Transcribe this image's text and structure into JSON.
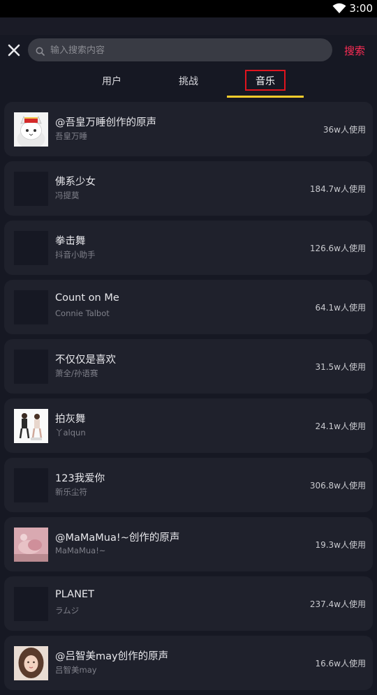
{
  "status_bar": {
    "time": "3:00",
    "wifi_icon": "wifi-icon"
  },
  "search": {
    "placeholder": "输入搜索内容",
    "value": "",
    "submit_label": "搜索"
  },
  "tabs": [
    {
      "label": "用户",
      "selected": false
    },
    {
      "label": "挑战",
      "selected": false
    },
    {
      "label": "音乐",
      "selected": true
    }
  ],
  "colors": {
    "accent": "#fe2c55",
    "tab_indicator": "#facd2c",
    "highlight_box": "#e0141e",
    "background": "#161823",
    "card": "#1f212c"
  },
  "music_list": [
    {
      "title": "@吾皇万睡创作的原声",
      "author": "吾皇万睡",
      "uses": "36w人使用",
      "cover": "cat-king-avatar"
    },
    {
      "title": "佛系少女",
      "author": "冯提莫",
      "uses": "184.7w人使用",
      "cover": "blank"
    },
    {
      "title": "拳击舞",
      "author": "抖音小助手",
      "uses": "126.6w人使用",
      "cover": "blank"
    },
    {
      "title": "Count on Me",
      "author": "Connie Talbot",
      "uses": "64.1w人使用",
      "cover": "blank"
    },
    {
      "title": "不仅仅是喜欢",
      "author": "萧全/孙语赛",
      "uses": "31.5w人使用",
      "cover": "blank"
    },
    {
      "title": "拍灰舞",
      "author": "丫alqun",
      "uses": "24.1w人使用",
      "cover": "dancers-photo"
    },
    {
      "title": "123我爱你",
      "author": "新乐尘符",
      "uses": "306.8w人使用",
      "cover": "blank"
    },
    {
      "title": "@MaMaMua!~创作的原声",
      "author": "MaMaMua!~",
      "uses": "19.3w人使用",
      "cover": "pink-photo"
    },
    {
      "title": "PLANET",
      "author": "ラムジ",
      "uses": "237.4w人使用",
      "cover": "blank"
    },
    {
      "title": "@吕智美may创作的原声",
      "author": "吕智美may",
      "uses": "16.6w人使用",
      "cover": "girl-portrait"
    }
  ]
}
